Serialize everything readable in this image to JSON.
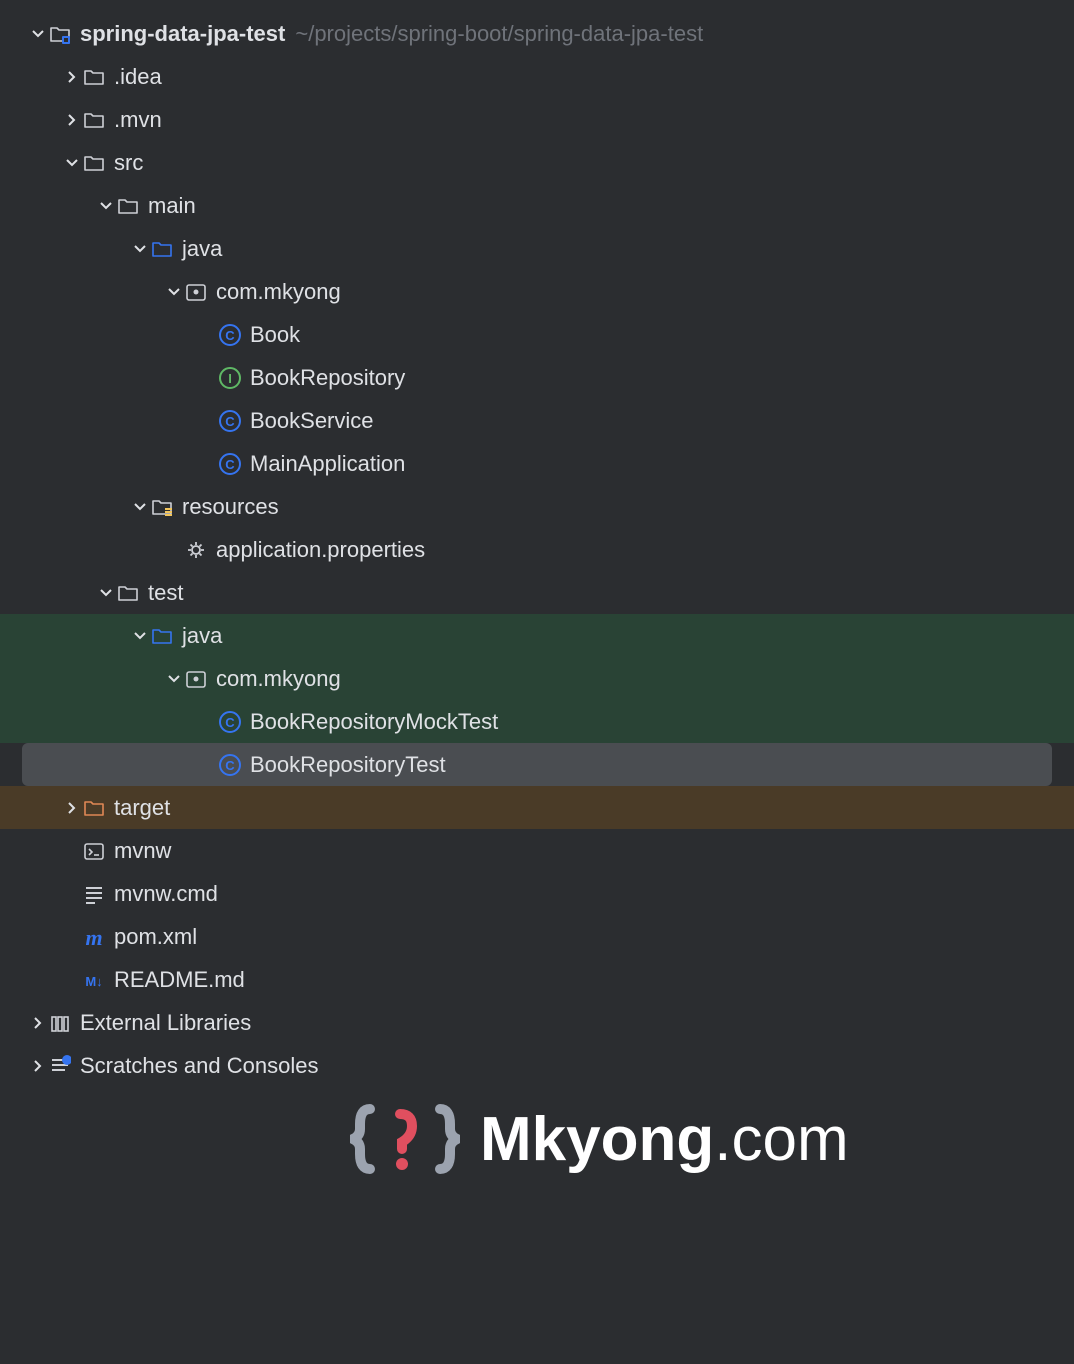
{
  "root": {
    "name": "spring-data-jpa-test",
    "path": "~/projects/spring-boot/spring-data-jpa-test"
  },
  "nodes": {
    "idea": ".idea",
    "mvn": ".mvn",
    "src": "src",
    "main": "main",
    "java1": "java",
    "pkg1": "com.mkyong",
    "book": "Book",
    "bookRepo": "BookRepository",
    "bookService": "BookService",
    "mainApp": "MainApplication",
    "resources": "resources",
    "appProps": "application.properties",
    "test": "test",
    "java2": "java",
    "pkg2": "com.mkyong",
    "mockTest": "BookRepositoryMockTest",
    "repoTest": "BookRepositoryTest",
    "target": "target",
    "mvnw": "mvnw",
    "mvnwCmd": "mvnw.cmd",
    "pom": "pom.xml",
    "readme": "README.md",
    "extLibs": "External Libraries",
    "scratches": "Scratches and Consoles"
  },
  "watermark": {
    "bold": "Mkyong",
    "rest": ".com"
  }
}
